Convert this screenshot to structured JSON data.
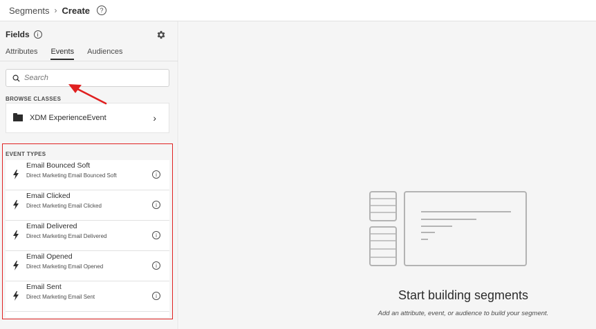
{
  "breadcrumb": {
    "parent": "Segments",
    "separator": "›",
    "current": "Create",
    "help_glyph": "?"
  },
  "sidebar": {
    "title": "Fields",
    "info_glyph": "i",
    "tabs": [
      {
        "label": "Attributes",
        "active": false
      },
      {
        "label": "Events",
        "active": true
      },
      {
        "label": "Audiences",
        "active": false
      }
    ],
    "search_placeholder": "Search",
    "browse_label": "BROWSE CLASSES",
    "class_item": {
      "label": "XDM ExperienceEvent",
      "icon": "folder-icon",
      "chevron": "›"
    },
    "event_types_label": "EVENT TYPES",
    "events": [
      {
        "title": "Email Bounced Soft",
        "subtitle": "Direct Marketing Email Bounced Soft"
      },
      {
        "title": "Email Clicked",
        "subtitle": "Direct Marketing Email Clicked"
      },
      {
        "title": "Email Delivered",
        "subtitle": "Direct Marketing Email Delivered"
      },
      {
        "title": "Email Opened",
        "subtitle": "Direct Marketing Email Opened"
      },
      {
        "title": "Email Sent",
        "subtitle": "Direct Marketing Email Sent"
      }
    ],
    "event_info_glyph": "i"
  },
  "canvas": {
    "title": "Start building segments",
    "subtitle": "Add an attribute, event, or audience to build your segment."
  },
  "colors": {
    "highlight": "#e02020",
    "panel_bg": "#f5f5f5",
    "text": "#2c2c2c"
  }
}
